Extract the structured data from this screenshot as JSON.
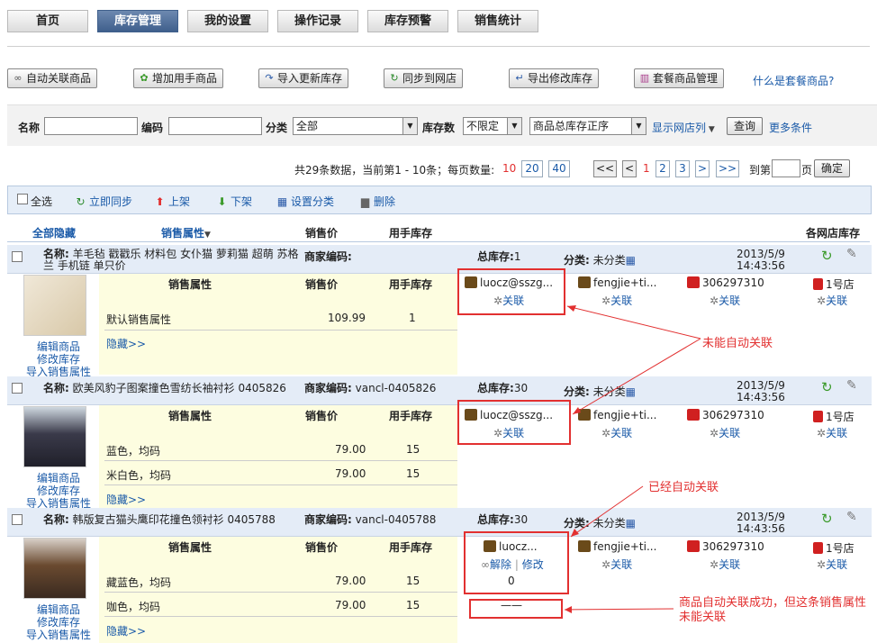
{
  "nav": {
    "tabs": [
      "首页",
      "库存管理",
      "我的设置",
      "操作记录",
      "库存预警",
      "销售统计"
    ],
    "active": "库存管理"
  },
  "actions": {
    "buttons": [
      "自动关联商品",
      "增加用手商品",
      "导入更新库存",
      "同步到网店",
      "导出修改库存",
      "套餐商品管理"
    ],
    "help_link": "什么是套餐商品?"
  },
  "filter": {
    "name_label": "名称",
    "code_label": "编码",
    "category_label": "分类",
    "category_value": "全部",
    "stock_label": "库存数",
    "stock_value": "不限定",
    "sort_value": "商品总库存正序",
    "show_shops": "显示网店列",
    "query_button": "查询",
    "more_link": "更多条件"
  },
  "pager": {
    "summary": "共29条数据，当前第1 - 10条；每页数量:",
    "page_sizes": [
      "10",
      "20",
      "40"
    ],
    "current_size": "10",
    "first": "<<",
    "prev": "<",
    "pages": [
      "1",
      "2",
      "3"
    ],
    "current_page": "1",
    "next": ">",
    "last": ">>",
    "goto_prefix": "到第",
    "goto_suffix": "页",
    "confirm": "确定"
  },
  "toolbar": {
    "select_all": "全选",
    "sync_now": "立即同步",
    "shelve_up": "上架",
    "shelve_down": "下架",
    "set_category": "设置分类",
    "delete": "删除"
  },
  "list_header": {
    "hide_all": "全部隐藏",
    "sales_attr": "销售属性",
    "price": "销售价",
    "stock": "用手库存",
    "shop_stock": "各网店库存"
  },
  "labels": {
    "name": "名称:",
    "merchant_code": "商家编码:",
    "total_stock": "总库存:",
    "category": "分类:",
    "sales_attr": "销售属性",
    "price": "销售价",
    "stock": "用手库存",
    "hide_link": "隐藏>>",
    "edit_product": "编辑商品",
    "edit_stock": "修改库存",
    "import_attr": "导入销售属性",
    "link": "关联",
    "unlink": "解除",
    "modify": "修改"
  },
  "products": [
    {
      "name": "羊毛毡 戳戳乐 材料包 女仆猫 萝莉猫 超萌 苏格兰 手机链 单只价",
      "merchant_code": "",
      "total_stock": "1",
      "category": "未分类",
      "date": "2013/5/9",
      "time": "14:43:56",
      "variants": [
        {
          "attr": "默认销售属性",
          "price": "109.99",
          "stock": "1"
        }
      ],
      "shops": [
        "luocz@sszg...",
        "fengjie+ti...",
        "306297310",
        "1号店"
      ]
    },
    {
      "name": "欧美风豹子图案撞色雪纺长袖衬衫 0405826",
      "merchant_code": "vancl-0405826",
      "total_stock": "30",
      "category": "未分类",
      "date": "2013/5/9",
      "time": "14:43:56",
      "variants": [
        {
          "attr": "蓝色，均码",
          "price": "79.00",
          "stock": "15"
        },
        {
          "attr": "米白色，均码",
          "price": "79.00",
          "stock": "15"
        }
      ],
      "shops": [
        "luocz@sszg...",
        "fengjie+ti...",
        "306297310",
        "1号店"
      ]
    },
    {
      "name": "韩版复古猫头鹰印花撞色领衬衫 0405788",
      "merchant_code": "vancl-0405788",
      "total_stock": "30",
      "category": "未分类",
      "date": "2013/5/9",
      "time": "14:43:56",
      "variants": [
        {
          "attr": "藏蓝色，均码",
          "price": "79.00",
          "stock": "15"
        },
        {
          "attr": "咖色，均码",
          "price": "79.00",
          "stock": "15"
        }
      ],
      "shops": [
        "luocz...",
        "fengjie+ti...",
        "306297310",
        "1号店"
      ],
      "linked_stock": "0",
      "unlinked_mark": "——"
    }
  ],
  "annotations": {
    "not_linked": "未能自动关联",
    "linked": "已经自动关联",
    "partial": "商品自动关联成功，但这条销售属性未能关联"
  },
  "colors": {
    "nav_active": "#4a6a96",
    "annotation": "#e23030",
    "link": "#1a5aa8",
    "product_header": "#e4ecf7",
    "variant_bg": "#fdfde0"
  }
}
